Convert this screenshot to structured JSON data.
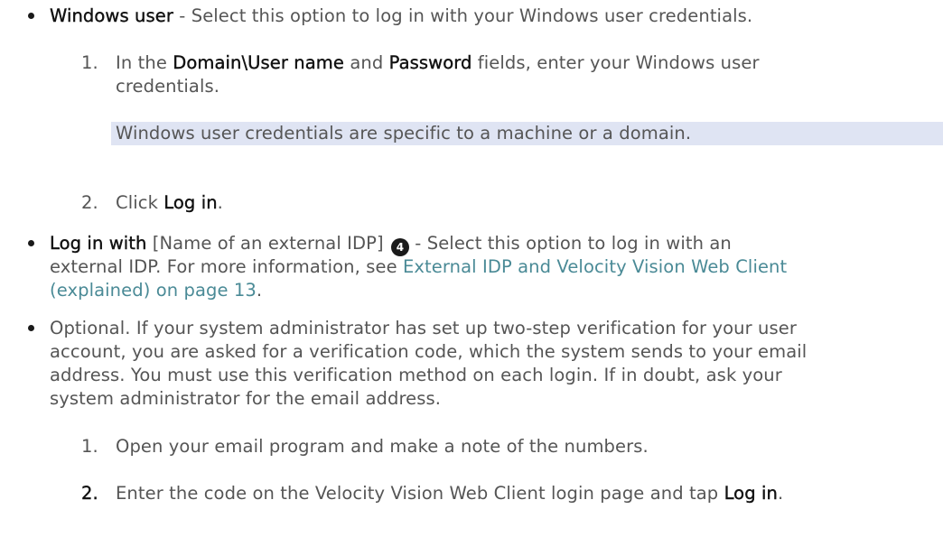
{
  "bullet1": {
    "term": "Windows user",
    "text": " - Select this option to log in with your Windows user credentials.",
    "steps": {
      "s1_num": "1.",
      "s1_a": "In the ",
      "s1_b": "Domain\\User name",
      "s1_c": " and ",
      "s1_d": "Password",
      "s1_e": " fields, enter your Windows user",
      "s1_line2": "credentials.",
      "note": "Windows user credentials are specific to a machine or a domain.",
      "s2_num": "2.",
      "s2_a": "Click ",
      "s2_b": "Log in",
      "s2_c": "."
    }
  },
  "bullet2": {
    "term": "Log in with",
    "bracket": " [Name of an external IDP] ",
    "badge": "4",
    "text": " - Select this option to log in with an",
    "line2_a": "external IDP. For more information, see ",
    "link_line2": "External IDP and Velocity Vision Web Client",
    "link_line3": "(explained) on page 13",
    "line3_end": "."
  },
  "bullet3": {
    "line1": "Optional. If your system administrator has set up two-step verification for your user",
    "line2": "account, you are asked for a verification code, which the system sends to your email",
    "line3": "address. You must use this verification method on each login. If in doubt, ask your",
    "line4": "system administrator for the email address.",
    "steps": {
      "s1_num": "1.",
      "s1_text": "Open your email program and make a note of the numbers.",
      "s2_num": "2.",
      "s2_a": "Enter the code on the Velocity Vision Web Client login page and tap ",
      "s2_b": "Log in",
      "s2_c": "."
    }
  }
}
